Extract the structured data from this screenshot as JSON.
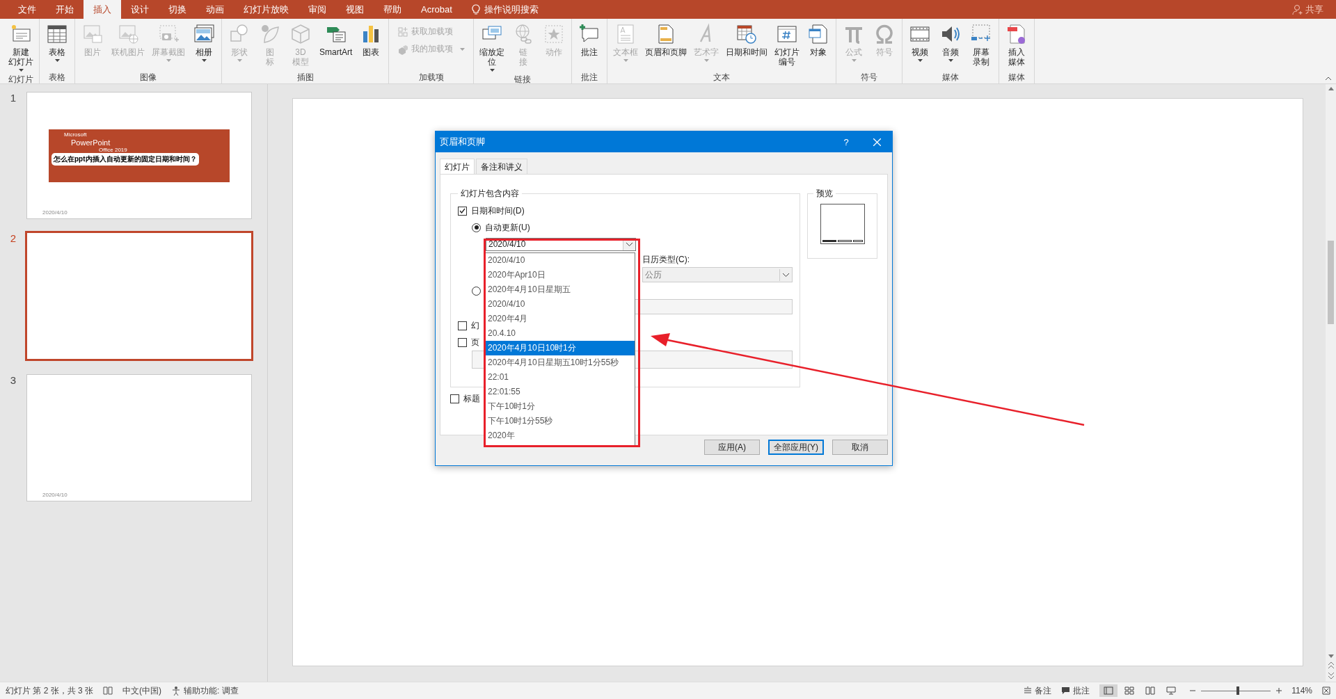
{
  "tabs": [
    {
      "label": "文件",
      "selected": false
    },
    {
      "label": "开始",
      "selected": false
    },
    {
      "label": "插入",
      "selected": true
    },
    {
      "label": "设计",
      "selected": false
    },
    {
      "label": "切换",
      "selected": false
    },
    {
      "label": "动画",
      "selected": false
    },
    {
      "label": "幻灯片放映",
      "selected": false
    },
    {
      "label": "审阅",
      "selected": false
    },
    {
      "label": "视图",
      "selected": false
    },
    {
      "label": "帮助",
      "selected": false
    },
    {
      "label": "Acrobat",
      "selected": false
    }
  ],
  "tell_me": "操作说明搜索",
  "share": "共享",
  "ribbon": [
    {
      "label": "幻灯片",
      "buttons": [
        {
          "lines": [
            "新建",
            "幻灯片"
          ],
          "dropdown": true,
          "disabled": false
        }
      ]
    },
    {
      "label": "表格",
      "buttons": [
        {
          "lines": [
            "表格"
          ],
          "dropdown": true,
          "disabled": false
        }
      ]
    },
    {
      "label": "图像",
      "buttons": [
        {
          "lines": [
            "图片"
          ],
          "dropdown": false,
          "disabled": true
        },
        {
          "lines": [
            "联机图片"
          ],
          "dropdown": false,
          "disabled": true
        },
        {
          "lines": [
            "屏幕截图"
          ],
          "dropdown": true,
          "disabled": true
        },
        {
          "lines": [
            "相册"
          ],
          "dropdown": true,
          "disabled": false
        }
      ]
    },
    {
      "label": "插图",
      "buttons": [
        {
          "lines": [
            "形状"
          ],
          "dropdown": true,
          "disabled": true
        },
        {
          "lines": [
            "图",
            "标"
          ],
          "dropdown": false,
          "disabled": true
        },
        {
          "lines": [
            "3D",
            "模型"
          ],
          "dropdown": false,
          "disabled": true
        },
        {
          "lines": [
            "SmartArt"
          ],
          "dropdown": false,
          "disabled": false
        },
        {
          "lines": [
            "图表"
          ],
          "dropdown": false,
          "disabled": false
        }
      ]
    },
    {
      "label": "加载项",
      "kind": "small",
      "buttons": [
        {
          "lines": [
            "获取加载项"
          ],
          "dropdown": false,
          "disabled": true
        },
        {
          "lines": [
            "我的加载项"
          ],
          "dropdown": true,
          "disabled": true
        }
      ]
    },
    {
      "label": "链接",
      "buttons": [
        {
          "lines": [
            "缩放定",
            "位"
          ],
          "dropdown": true,
          "disabled": false
        },
        {
          "lines": [
            "链",
            "接"
          ],
          "dropdown": false,
          "disabled": true
        },
        {
          "lines": [
            "动作"
          ],
          "dropdown": false,
          "disabled": true
        }
      ]
    },
    {
      "label": "批注",
      "buttons": [
        {
          "lines": [
            "批注"
          ],
          "dropdown": false,
          "disabled": false
        }
      ]
    },
    {
      "label": "文本",
      "buttons": [
        {
          "lines": [
            "文本框"
          ],
          "dropdown": true,
          "disabled": true
        },
        {
          "lines": [
            "页眉和页脚"
          ],
          "dropdown": false,
          "disabled": false
        },
        {
          "lines": [
            "艺术字"
          ],
          "dropdown": true,
          "disabled": true
        },
        {
          "lines": [
            "日期和时间"
          ],
          "dropdown": false,
          "disabled": false
        },
        {
          "lines": [
            "幻灯片",
            "编号"
          ],
          "dropdown": false,
          "disabled": false
        },
        {
          "lines": [
            "对象"
          ],
          "dropdown": false,
          "disabled": false
        }
      ]
    },
    {
      "label": "符号",
      "buttons": [
        {
          "lines": [
            "公式"
          ],
          "dropdown": true,
          "disabled": true
        },
        {
          "lines": [
            "符号"
          ],
          "dropdown": false,
          "disabled": true
        }
      ]
    },
    {
      "label": "媒体",
      "buttons": [
        {
          "lines": [
            "视频"
          ],
          "dropdown": true,
          "disabled": false
        },
        {
          "lines": [
            "音频"
          ],
          "dropdown": true,
          "disabled": false
        },
        {
          "lines": [
            "屏幕",
            "录制"
          ],
          "dropdown": false,
          "disabled": false
        }
      ]
    },
    {
      "label": "媒体",
      "buttons": [
        {
          "lines": [
            "插入",
            "媒体"
          ],
          "dropdown": false,
          "disabled": false
        }
      ]
    }
  ],
  "slides": [
    {
      "number": "1",
      "selected": false,
      "kind": "title",
      "logo": "Microsoft",
      "brand": "PowerPoint",
      "edition": "Office 2019",
      "title": "怎么在ppt内插入自动更新的固定日期和时间？",
      "footer": "2020/4/10"
    },
    {
      "number": "2",
      "selected": true,
      "kind": "blank"
    },
    {
      "number": "3",
      "selected": false,
      "kind": "blank",
      "footer": "2020/4/10"
    }
  ],
  "dialog": {
    "title": "页眉和页脚",
    "help": "?",
    "tabs": [
      {
        "label": "幻灯片",
        "selected": true
      },
      {
        "label": "备注和讲义",
        "selected": false
      }
    ],
    "group_title": "幻灯片包含内容",
    "date_time": {
      "label": "日期和时间(D)",
      "checked": true
    },
    "auto_update": {
      "label": "自动更新(U)",
      "selected": true
    },
    "format_combo": {
      "value": "2020/4/10"
    },
    "format_options": [
      {
        "label": "2020/4/10",
        "selected": false
      },
      {
        "label": "2020年Apr10日",
        "selected": false
      },
      {
        "label": "2020年4月10日星期五",
        "selected": false
      },
      {
        "label": "2020/4/10",
        "selected": false
      },
      {
        "label": "2020年4月",
        "selected": false
      },
      {
        "label": "20.4.10",
        "selected": false
      },
      {
        "label": "2020年4月10日10时1分",
        "selected": true
      },
      {
        "label": "2020年4月10日星期五10时1分55秒",
        "selected": false
      },
      {
        "label": "22:01",
        "selected": false
      },
      {
        "label": "22:01:55",
        "selected": false
      },
      {
        "label": "下午10时1分",
        "selected": false
      },
      {
        "label": "下午10时1分55秒",
        "selected": false
      },
      {
        "label": "2020年",
        "selected": false
      }
    ],
    "calendar_label": "日历类型(C):",
    "calendar_value": "公历",
    "fixed": {
      "selected": false
    },
    "slide_number": {
      "label": "幻",
      "checked": false
    },
    "footer": {
      "label": "页",
      "checked": false
    },
    "title_slide": {
      "label": "标题",
      "checked": false
    },
    "preview_title": "预览",
    "buttons": [
      {
        "label": "应用(A)",
        "default": false
      },
      {
        "label": "全部应用(Y)",
        "default": true
      },
      {
        "label": "取消",
        "default": false
      }
    ]
  },
  "markup": {
    "frame": true,
    "arrow": true
  },
  "status": {
    "slide_info": "幻灯片 第 2 张，共 3 张",
    "language": "中文(中国)",
    "accessibility": "辅助功能: 调查",
    "notes": "备注",
    "comments": "批注",
    "views": [
      {
        "selected": true
      },
      {
        "selected": false
      },
      {
        "selected": false
      },
      {
        "selected": false
      }
    ],
    "level": 0.53,
    "zoom": "114%"
  }
}
